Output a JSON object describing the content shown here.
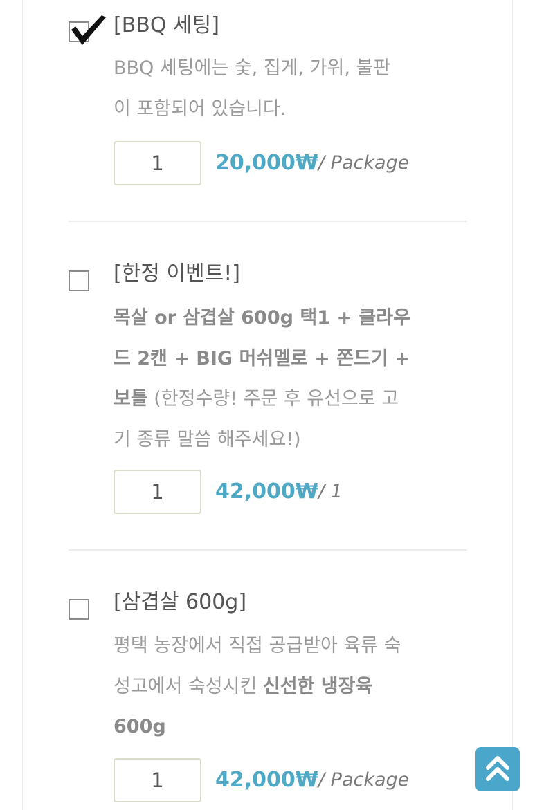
{
  "options": [
    {
      "title": "[BBQ 세팅]",
      "checked": true,
      "desc_lines": [
        "BBQ 세팅에는 숯, 집게, 가위, 불판",
        "이 포함되어 있습니다."
      ],
      "quantity": "1",
      "price": "20,000₩",
      "unit": "/ Package"
    },
    {
      "title": "[한정 이벤트!]",
      "checked": false,
      "desc_bold_1": "목살 or 삼겹살 600g 택1 + 클라우",
      "desc_bold_2": "드 2캔 + BIG 머쉬멜로 + 쫀드기 +",
      "desc_bold_3": "보틀",
      "desc_rest_3": " (한정수량! 주문 후 유선으로 고",
      "desc_rest_4": "기 종류 말씀 해주세요!)",
      "quantity": "1",
      "price": "42,000₩",
      "unit": "/ 1"
    },
    {
      "title": "[삼겹살 600g]",
      "checked": false,
      "desc_line_1": "평택 농장에서 직접 공급받아 육류 숙",
      "desc_line_2_plain": "성고에서 숙성시킨 ",
      "desc_line_2_bold": "신선한 냉장육",
      "desc_line_3_bold": "600g",
      "quantity": "1",
      "price": "42,000₩",
      "unit": "/ Package"
    }
  ],
  "scroll_top_icon": "double-chevron-up-icon",
  "colors": {
    "price": "#4fa8c4",
    "scroll_button": "#4aa7cb",
    "title": "#555555",
    "description": "#9a9a9a"
  }
}
